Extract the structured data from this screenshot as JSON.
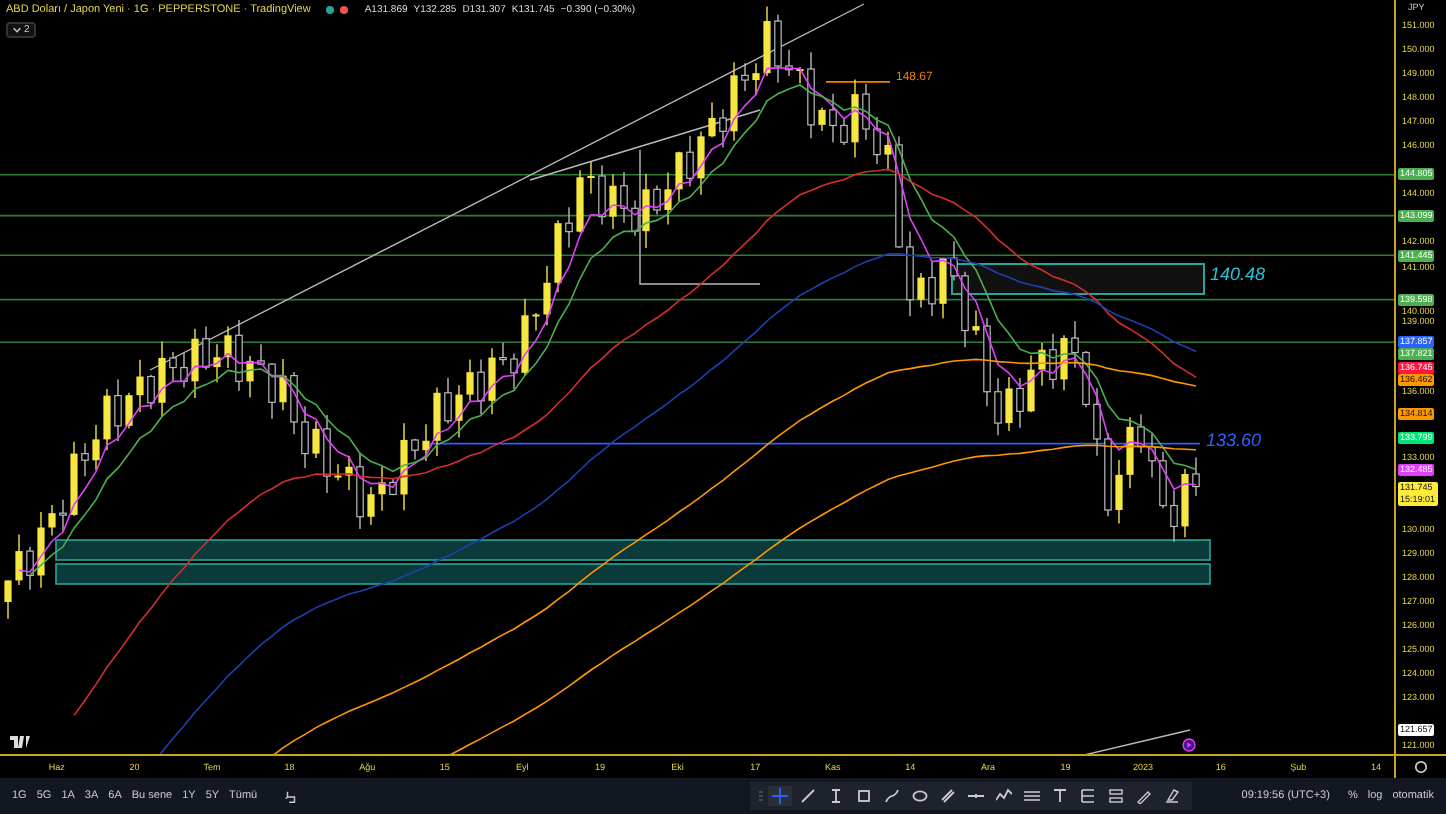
{
  "header": {
    "title": "ABD Doları / Japon Yeni · 1G · PEPPERSTONE · TradingView",
    "ohlc": [
      "A131.869",
      "Y132.285",
      "D131.307",
      "K131.745"
    ],
    "change": "−0.390 (−0.30%)",
    "collapse": "2"
  },
  "annotations": [
    {
      "text": "148.67",
      "color": "#f57c00"
    },
    {
      "text": "140.48",
      "color": "#26c6da"
    },
    {
      "text": "133.60",
      "color": "#2962ff"
    }
  ],
  "price_axis": {
    "currency": "JPY",
    "labels": [
      "151.000",
      "150.000",
      "149.000",
      "148.000",
      "147.000",
      "146.000",
      "144.000",
      "142.000",
      "141.000",
      "140.000",
      "139.000",
      "136.000",
      "133.000",
      "130.000",
      "129.000",
      "128.000",
      "127.000",
      "126.000",
      "125.000",
      "124.000",
      "123.000",
      "121.000"
    ],
    "tags": [
      {
        "value": "144.805",
        "color": "#4caf50"
      },
      {
        "value": "143.099",
        "color": "#4caf50"
      },
      {
        "value": "141.445",
        "color": "#4caf50"
      },
      {
        "value": "139.598",
        "color": "#4caf50"
      },
      {
        "value": "137.857",
        "color": "#2962ff"
      },
      {
        "value": "137.821",
        "color": "#4caf50"
      },
      {
        "value": "136.745",
        "color": "#ff1744"
      },
      {
        "value": "136.462",
        "color": "#ff9800"
      },
      {
        "value": "134.814",
        "color": "#ff9800"
      },
      {
        "value": "133.799",
        "color": "#00e676"
      },
      {
        "value": "132.485",
        "color": "#e040fb"
      },
      {
        "value": "131.745",
        "color": "#ffeb3b",
        "time": "15:19:01"
      },
      {
        "value": "121.657",
        "color": "#ffffff"
      }
    ]
  },
  "time_axis": [
    "Haz",
    "20",
    "Tem",
    "18",
    "Ağu",
    "15",
    "Eyl",
    "19",
    "Eki",
    "17",
    "Kas",
    "14",
    "Ara",
    "19",
    "2023",
    "16",
    "Şub",
    "14"
  ],
  "toolbar": {
    "ranges": [
      "1G",
      "5G",
      "1A",
      "3A",
      "6A",
      "Bu sene",
      "1Y",
      "5Y",
      "Tümü"
    ],
    "tools": [
      {
        "kind": "crosshair",
        "selected": true
      },
      {
        "kind": "trendline",
        "selected": false
      },
      {
        "kind": "cursor",
        "selected": false
      },
      {
        "kind": "rectangle",
        "selected": false
      },
      {
        "kind": "brush",
        "selected": false
      },
      {
        "kind": "ellipse",
        "selected": false
      },
      {
        "kind": "ruler",
        "selected": false
      },
      {
        "kind": "hline",
        "selected": false
      },
      {
        "kind": "pattern",
        "selected": false
      },
      {
        "kind": "channel",
        "selected": false
      },
      {
        "kind": "text",
        "selected": false
      },
      {
        "kind": "fib",
        "selected": false
      },
      {
        "kind": "fibalt",
        "selected": false
      },
      {
        "kind": "pen",
        "selected": false
      },
      {
        "kind": "eraser",
        "selected": false
      }
    ],
    "clock": "09:19:56 (UTC+3)",
    "options": [
      "%",
      "log",
      "otomatik"
    ]
  }
}
